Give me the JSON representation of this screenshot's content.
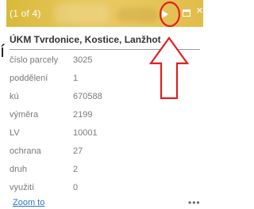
{
  "edge_glyph": "í",
  "header": {
    "pager": "(1 of 4)",
    "next_icon": "play-right-icon",
    "dock_icon": "dock-icon",
    "close_icon": "close-icon",
    "close_glyph": "×",
    "accent_color": "#e3c352"
  },
  "popup": {
    "title": "ÚKM Tvrdonice, Kostice, Lanžhot",
    "attributes": [
      {
        "key": "číslo parcely",
        "value": "3025"
      },
      {
        "key": "poddělení",
        "value": "1"
      },
      {
        "key": "kú",
        "value": "670588"
      },
      {
        "key": "výměra",
        "value": "2199"
      },
      {
        "key": "LV",
        "value": "10001"
      },
      {
        "key": "ochrana",
        "value": "27"
      },
      {
        "key": "druh",
        "value": "2"
      },
      {
        "key": "využití",
        "value": "0"
      }
    ],
    "zoom_label": "Zoom to",
    "more_label": "•••"
  },
  "annotation": {
    "color": "#e0201f"
  }
}
